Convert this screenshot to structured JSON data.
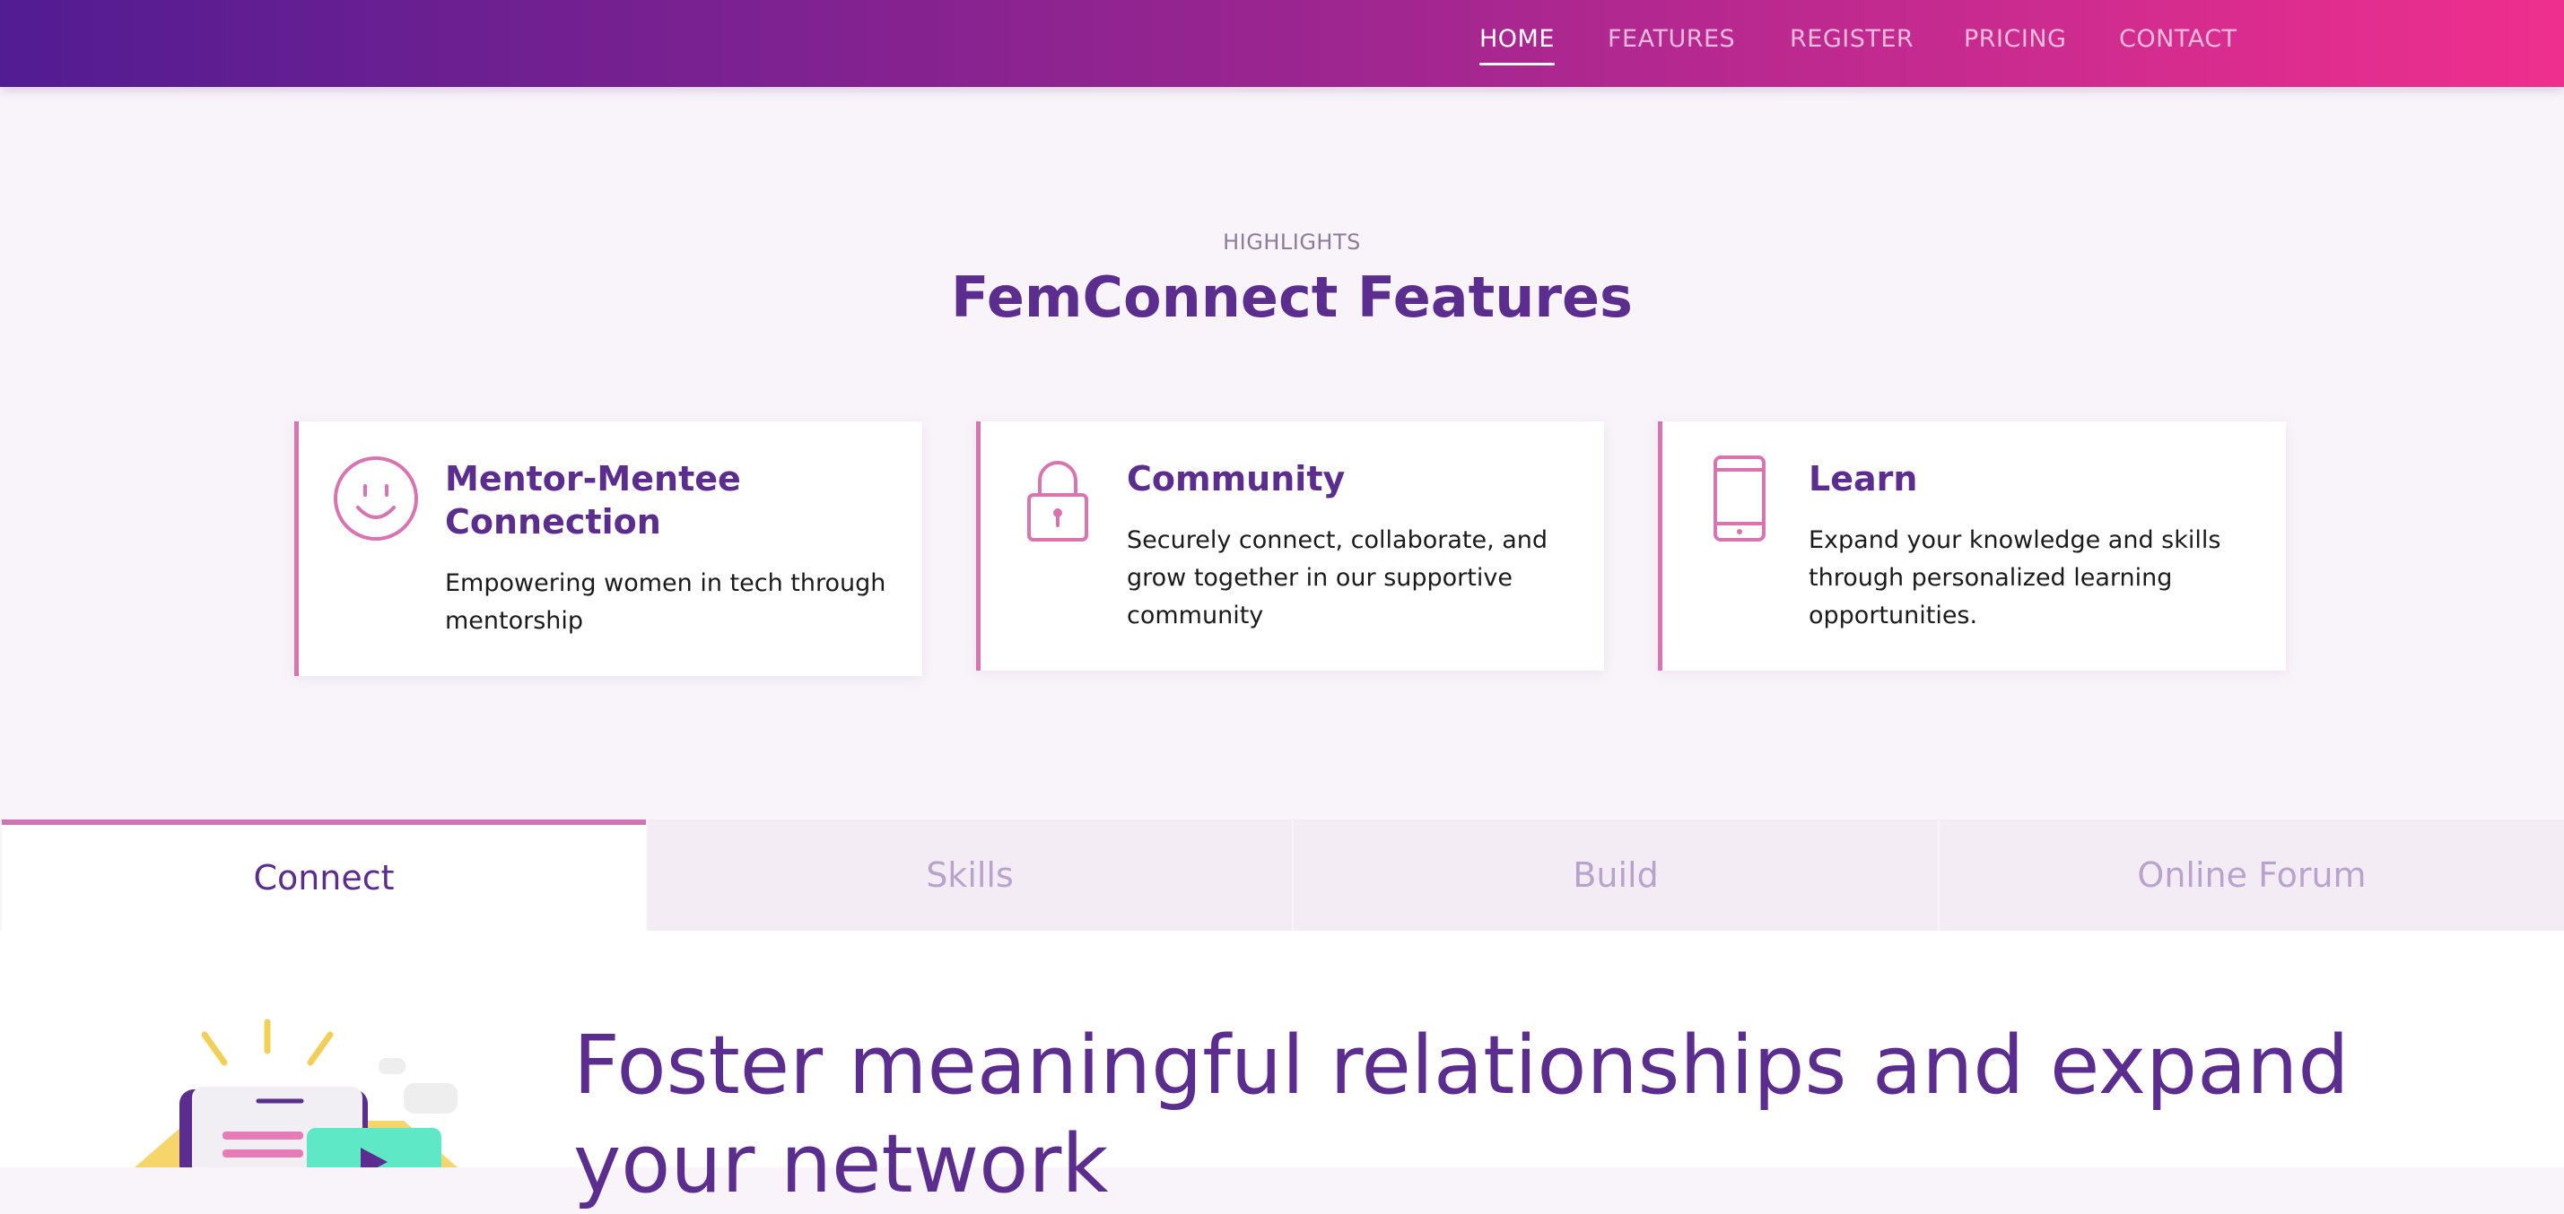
{
  "nav": {
    "items": [
      {
        "label": "HOME",
        "active": true
      },
      {
        "label": "FEATURES",
        "active": false
      },
      {
        "label": "REGISTER",
        "active": false
      },
      {
        "label": "PRICING",
        "active": false
      },
      {
        "label": "CONTACT",
        "active": false
      }
    ]
  },
  "highlights": {
    "eyebrow": "HIGHLIGHTS",
    "title": "FemConnect Features"
  },
  "cards": [
    {
      "icon": "smiley-icon",
      "title": "Mentor-Mentee Connection",
      "text": "Empowering women in tech through mentorship"
    },
    {
      "icon": "lock-icon",
      "title": "Community",
      "text": "Securely connect, collaborate, and grow together in our supportive community"
    },
    {
      "icon": "mobile-icon",
      "title": "Learn",
      "text": "Expand your knowledge and skills through personalized learning opportunities."
    }
  ],
  "tabs": [
    {
      "label": "Connect",
      "active": true
    },
    {
      "label": "Skills",
      "active": false
    },
    {
      "label": "Build",
      "active": false
    },
    {
      "label": "Online Forum",
      "active": false
    }
  ],
  "tab_content": {
    "headline": "Foster meaningful relationships and expand your network"
  },
  "colors": {
    "brand_purple": "#5b2d8e",
    "accent_pink": "#d874b0",
    "nav_gradient_start": "#521c92",
    "nav_gradient_end": "#ef2f8e"
  }
}
